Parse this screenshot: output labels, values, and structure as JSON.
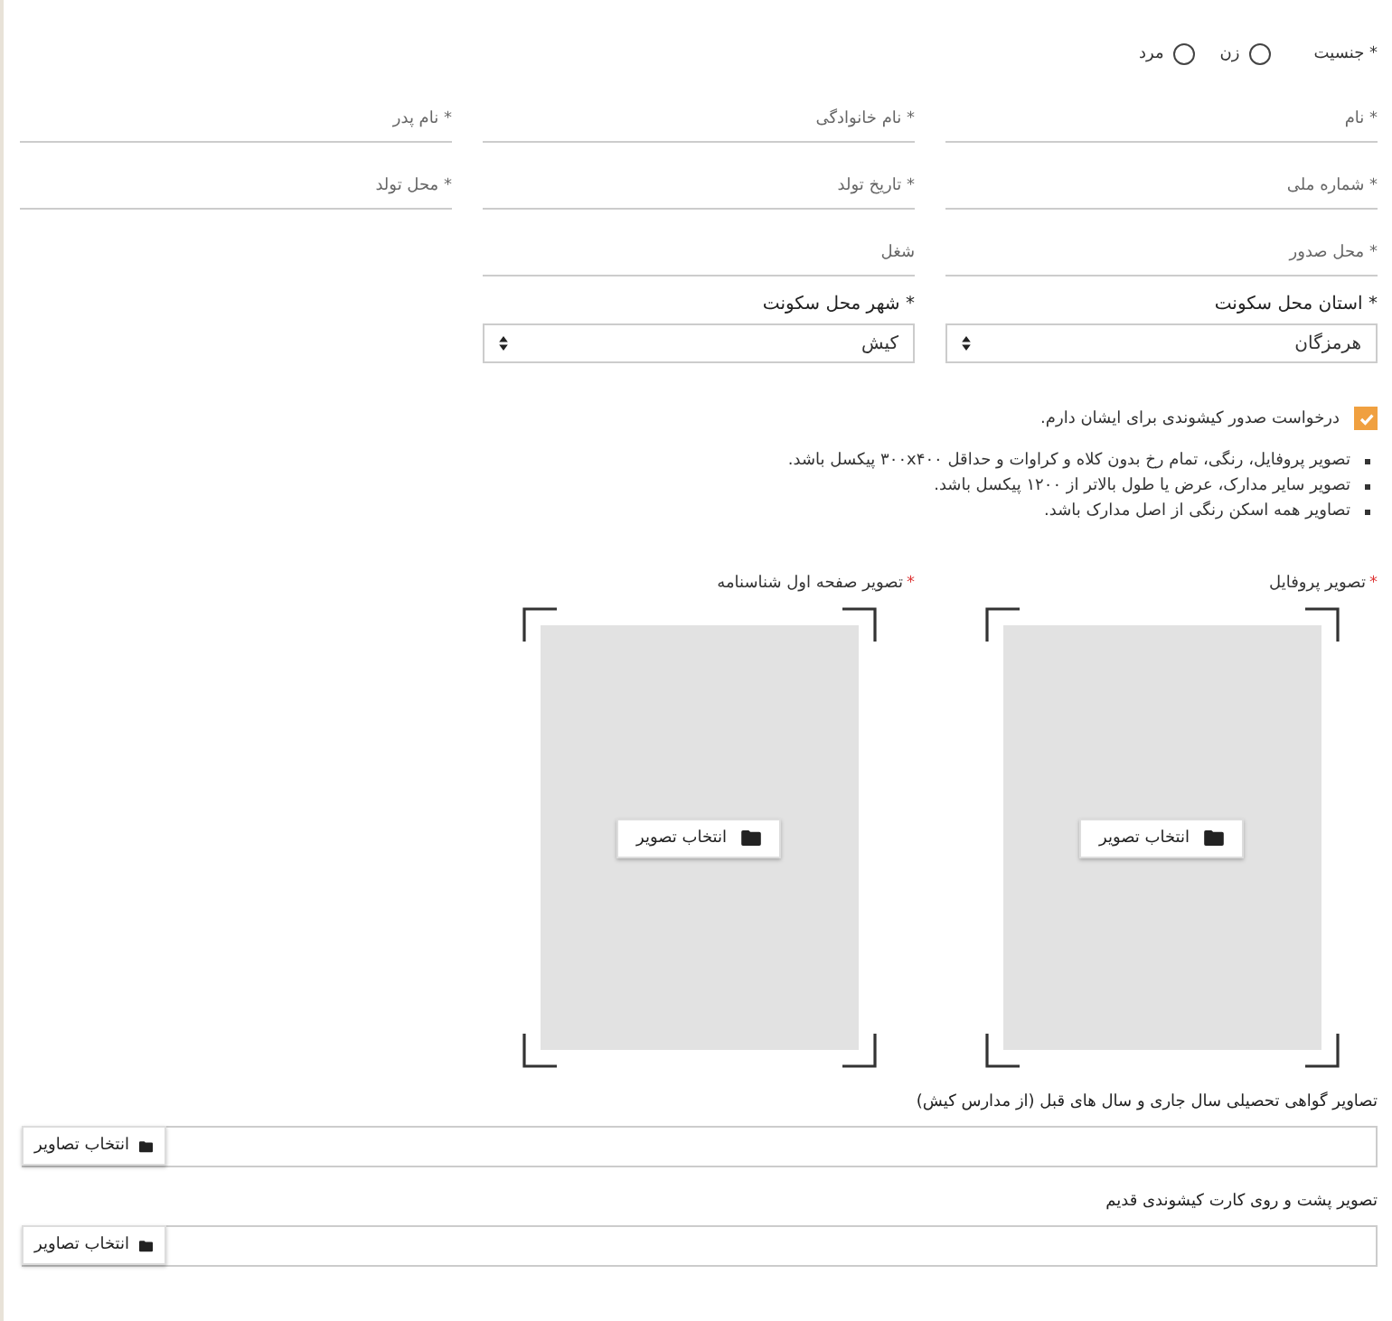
{
  "gender": {
    "label": "* جنسیت",
    "options": [
      {
        "label": "زن",
        "selected": false
      },
      {
        "label": "مرد",
        "selected": false
      }
    ]
  },
  "field_rows": [
    [
      {
        "label": "* نام"
      },
      {
        "label": "* نام خانوادگی"
      },
      {
        "label": "* نام پدر"
      }
    ],
    [
      {
        "label": "* شماره ملی"
      },
      {
        "label": "* تاریخ تولد"
      },
      {
        "label": "* محل تولد"
      }
    ],
    [
      {
        "label": "* محل صدور"
      },
      {
        "label": "شغل"
      }
    ]
  ],
  "selects": [
    {
      "label": "* استان محل سکونت",
      "value": "هرمزگان"
    },
    {
      "label": "* شهر محل سکونت",
      "value": "کیش"
    }
  ],
  "checkbox": {
    "label": "درخواست صدور کیشوندی برای ایشان دارم.",
    "checked": true
  },
  "notes": [
    "تصویر پروفایل، رنگی، تمام رخ بدون کلاه و کراوات و حداقل ۳۰۰x۴۰۰ پیکسل باشد.",
    "تصویر سایر مدارک، عرض یا طول بالاتر از ۱۲۰۰ پیکسل باشد.",
    "تصاویر همه اسکن رنگی از اصل مدارک باشد."
  ],
  "image_uploads": [
    {
      "asterisk": "*",
      "label": "تصویر پروفایل",
      "button": "انتخاب تصویر"
    },
    {
      "asterisk": "*",
      "label": "تصویر صفحه اول شناسنامه",
      "button": "انتخاب تصویر"
    }
  ],
  "file_uploads": [
    {
      "label": "تصاویر گواهی تحصیلی سال جاری و سال های قبل (از مدارس کیش)",
      "button": "انتخاب تصاویر"
    },
    {
      "label": "تصویر پشت و روی کارت کیشوندی قدیم",
      "button": "انتخاب تصاویر"
    }
  ]
}
